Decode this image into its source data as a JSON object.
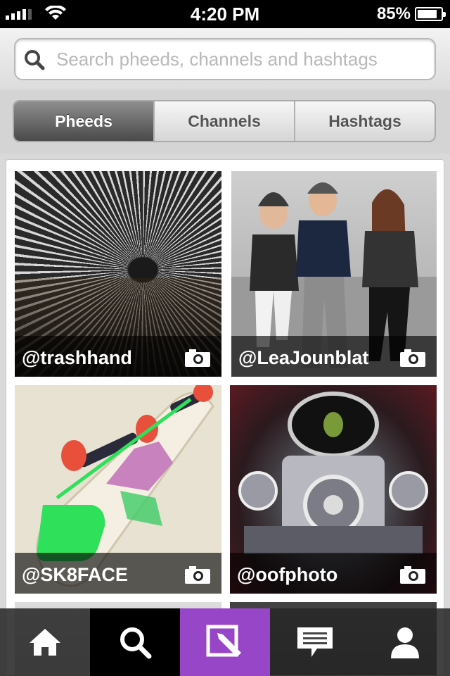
{
  "status_bar": {
    "time": "4:20 PM",
    "battery": "85%",
    "battery_level": 0.85,
    "signal_icon": "signal-bars-icon",
    "wifi_icon": "wifi-icon"
  },
  "search": {
    "placeholder": "Search pheeds, channels and hashtags",
    "value": "",
    "icon": "search-icon"
  },
  "segments": {
    "pheeds": "Pheeds",
    "channels": "Channels",
    "hashtags": "Hashtags",
    "selected": "Pheeds"
  },
  "grid": {
    "items": [
      {
        "handle": "@trashhand",
        "media_icon": "camera-icon"
      },
      {
        "handle": "@LeaJounblat",
        "media_icon": "camera-icon"
      },
      {
        "handle": "@SK8FACE",
        "media_icon": "camera-icon"
      },
      {
        "handle": "@oofphoto",
        "media_icon": "camera-icon"
      }
    ]
  },
  "tab_bar": {
    "tabs": [
      {
        "icon": "home-icon"
      },
      {
        "icon": "search-icon",
        "selected": true
      },
      {
        "icon": "compose-icon"
      },
      {
        "icon": "messages-icon"
      },
      {
        "icon": "profile-icon"
      }
    ]
  },
  "colors": {
    "accent": "#9846c8",
    "active_segment": "#5a5a5a",
    "status_bar": "#000000"
  }
}
